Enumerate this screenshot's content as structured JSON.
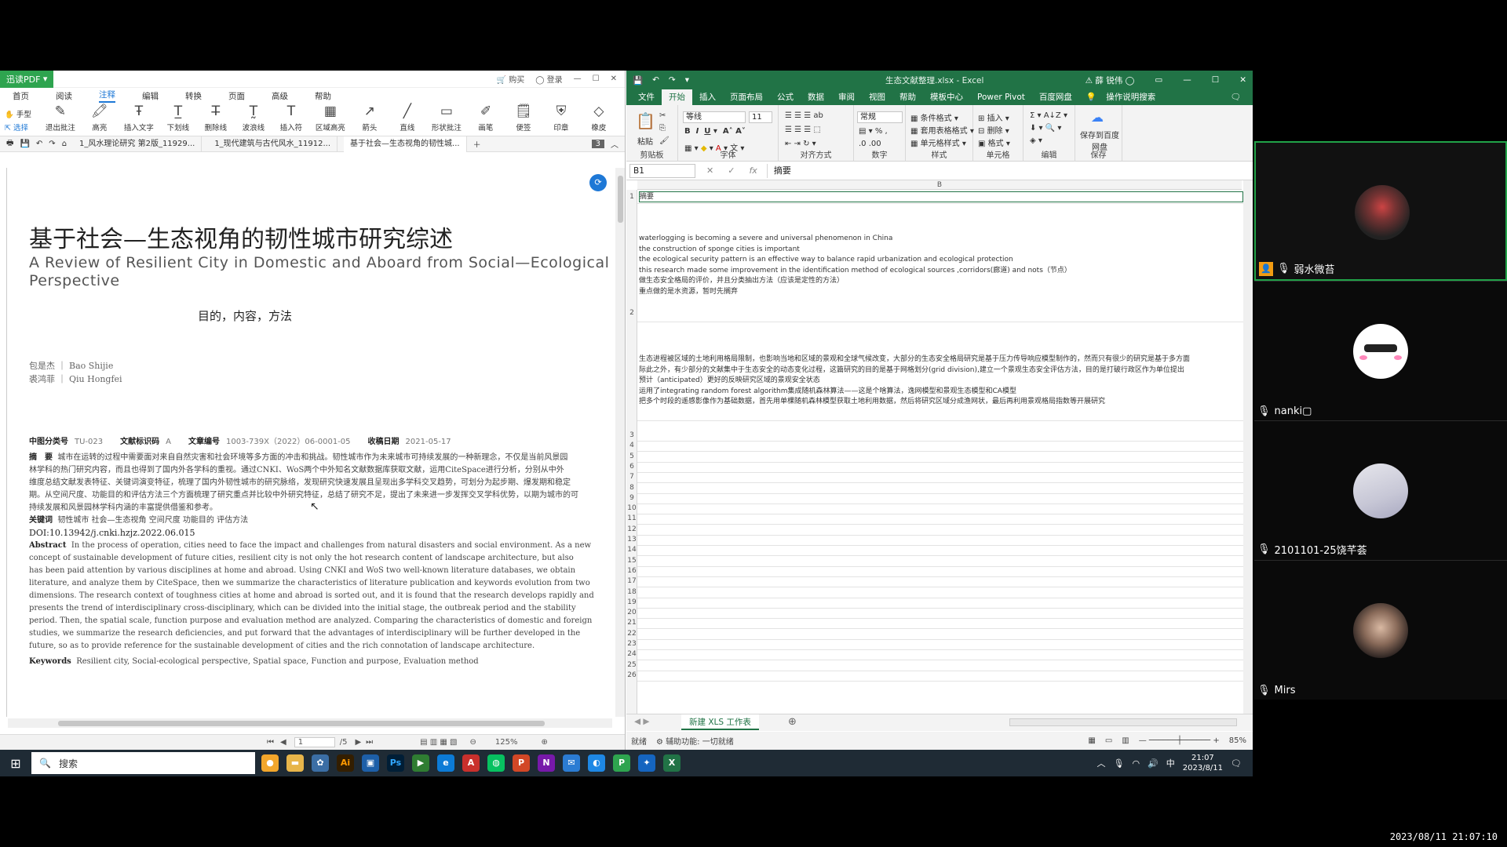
{
  "pdf": {
    "app_name": "迅读PDF",
    "titlebar": {
      "buy": "购买",
      "login": "登录"
    },
    "menu": [
      "首页",
      "阅读",
      "注释",
      "编辑",
      "转换",
      "页面",
      "高级",
      "帮助"
    ],
    "menu_active": "注释",
    "ribbon": {
      "hand": "手型",
      "select": "选择",
      "tools": [
        "退出批注",
        "高亮",
        "插入文字",
        "下划线",
        "删除线",
        "波浪线",
        "插入符",
        "区域高亮",
        "箭头",
        "直线",
        "形状批注",
        "画笔",
        "便签",
        "印章",
        "橡皮"
      ]
    },
    "tabs": [
      "1_风水理论研究  第2版_11929...",
      "1_现代建筑与古代风水_11912...",
      "基于社会—生态视角的韧性城..."
    ],
    "tab_count": "3",
    "page": {
      "title": "基于社会—生态视角的韧性城市研究综述",
      "subtitle": "A Review of Resilient City in Domestic and Aboard from Social—Ecological Perspective",
      "objective": "目的，内容，方法",
      "authors": [
        "包是杰 ｜ Bao Shijie",
        "裘鸿菲 ｜ Qiu Hongfei"
      ],
      "meta": [
        {
          "k": "中图分类号",
          "v": "TU-023"
        },
        {
          "k": "文献标识码",
          "v": "A"
        },
        {
          "k": "文章编号",
          "v": "1003-739X（2022）06-0001-05"
        },
        {
          "k": "收稿日期",
          "v": "2021-05-17"
        }
      ],
      "abstract_cn_label": "摘　要",
      "abstract_cn": [
        "城市在运转的过程中需要面对来自自然灾害和社会环境等多方面的冲击和挑战。韧性城市作为未来城市可持续发展的一种新理念，不仅是当前风景园",
        "林学科的热门研究内容，而且也得到了国内外各学科的重视。通过CNKI、WoS两个中外知名文献数据库获取文献，运用CiteSpace进行分析，分别从中外",
        "维度总结文献发表特征、关键词演变特征，梳理了国内外韧性城市的研究脉络，发现研究快速发展且呈现出多学科交叉趋势，可划分为起步期、爆发期和稳定",
        "期。从空间尺度、功能目的和评估方法三个方面梳理了研究重点并比较中外研究特征，总结了研究不足，提出了未来进一步发挥交叉学科优势，以期为城市的可",
        "持续发展和风景园林学科内涵的丰富提供借鉴和参考。"
      ],
      "keywords_cn_label": "关键词",
      "keywords_cn": "韧性城市  社会—生态视角  空间尺度  功能目的  评估方法",
      "doi": "DOI:10.13942/j.cnki.hzjz.2022.06.015",
      "abstract_en_label": "Abstract",
      "abstract_en": [
        "In the process of operation, cities need to face the impact and challenges from natural disasters and social environment. As a new",
        "concept of sustainable development of future cities, resilient city is not only the hot research content of landscape architecture, but also",
        "has been paid attention by various disciplines at home and abroad. Using CNKI and WoS two well-known literature databases, we obtain",
        "literature, and analyze them by CiteSpace, then we summarize the characteristics of literature publication and keywords evolution from two",
        "dimensions. The research context of toughness cities at home and abroad is sorted out, and it is found that the research develops rapidly and",
        "presents the trend of interdisciplinary cross-disciplinary, which can be divided into the initial stage, the outbreak period and the stability",
        "period. Then, the spatial scale, function purpose and evaluation method are analyzed. Comparing the characteristics of domestic and foreign",
        "studies, we summarize the research deficiencies, and put forward that the advantages of interdisciplinary will be further developed in the",
        "future, so as to provide reference for the sustainable development of cities and the rich connotation of landscape architecture."
      ],
      "keywords_en_label": "Keywords",
      "keywords_en": "Resilient city, Social-ecological perspective, Spatial space, Function and purpose, Evaluation method"
    },
    "status": {
      "page": "1",
      "total": "/5",
      "zoom": "125%"
    }
  },
  "excel": {
    "title": "生态文献整理.xlsx - Excel",
    "user": "薛 锐伟",
    "tabs": [
      "文件",
      "开始",
      "插入",
      "页面布局",
      "公式",
      "数据",
      "审阅",
      "视图",
      "帮助",
      "模板中心",
      "Power Pivot",
      "百度网盘",
      "操作说明搜索"
    ],
    "active_tab": "开始",
    "groups": [
      "剪贴板",
      "字体",
      "对齐方式",
      "数字",
      "样式",
      "单元格",
      "编辑",
      "保存"
    ],
    "paste": "粘贴",
    "font_name": "等线",
    "font_size": "11",
    "number_format": "常规",
    "styles": [
      "条件格式",
      "套用表格格式",
      "单元格样式"
    ],
    "cells_btns": [
      "插入",
      "删除",
      "格式"
    ],
    "save_baidu": "保存到百度网盘",
    "namebox": "B1",
    "formula": "摘要",
    "col_header": "B",
    "row1": "摘要",
    "row2_lines": [
      "waterlogging is becoming a severe and universal phenomenon in China",
      "the construction of sponge cities is important",
      "the ecological security pattern is an effective way to balance rapid urbanization and ecological protection",
      "this research made some improvement in the identification method of ecological sources ,corridors(廊道) and nots（节点）",
      "做生态安全格局的评价，并且分类抽出方法（应该是定性的方法）",
      "重点做的是水资源，暂时先搁弃"
    ],
    "row2b_lines": [
      "生态进程被区域的土地利用格局限制，也影响当地和区域的景观和全球气候改变，大部分的生态安全格局研究是基于压力传导响应模型制作的，然而只有很少的研究是基于多方面",
      "际此之外，有少部分的文献集中于生态安全的动态变化过程，这篇研究的目的是基于网格划分(grid division),建立一个景观生态安全评估方法，目的是打破行政区作为单位提出",
      "预计（anticipated）更好的反映研究区域的景观安全状态",
      "运用了integrating random forest algorithm集成随机森林算法——这是个啥算法，逸网模型和景观生态模型和CA模型",
      "把多个时段的遥感影像作为基础数据，首先用单棵随机森林模型获取土地利用数据，然后将研究区域分成渔网状，最后再利用景观格局指数等开展研究"
    ],
    "sheet_tab": "新建 XLS 工作表",
    "status_ready": "就绪",
    "status_access": "辅助功能: 一切就绪",
    "zoom": "85%"
  },
  "taskbar": {
    "search": "搜索",
    "time": "21:07",
    "date": "2023/8/11",
    "ime": "中"
  },
  "participants": [
    {
      "name": "弱水微苔",
      "active": true
    },
    {
      "name": "nanki▢",
      "active": false
    },
    {
      "name": "2101101-25饶芊荟",
      "active": false
    },
    {
      "name": "Mirs",
      "active": false
    }
  ],
  "timestamp": "2023/08/11 21:07:10",
  "colors": {
    "excel_green": "#217346",
    "pdf_blue": "#1e78d6",
    "speaker_border": "#21a348"
  }
}
